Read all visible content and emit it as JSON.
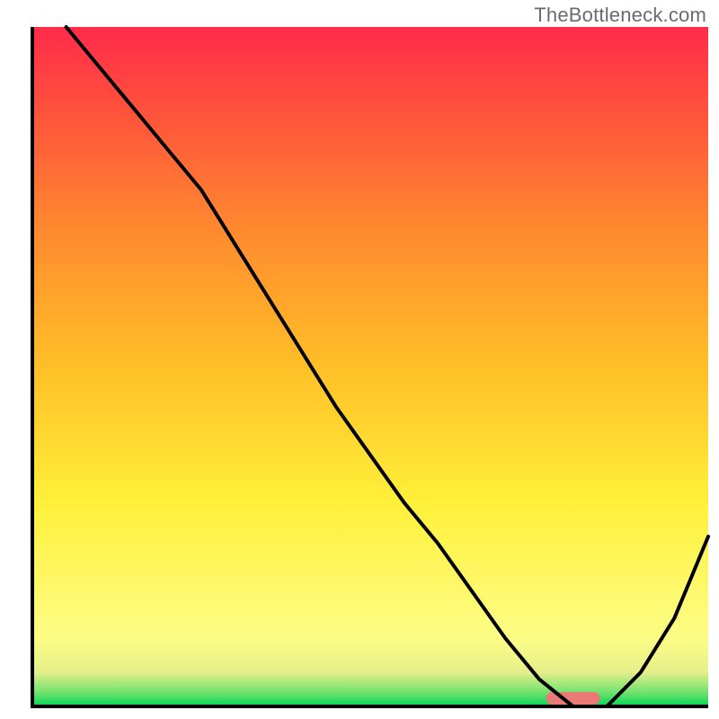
{
  "watermark": "TheBottleneck.com",
  "chart_data": {
    "type": "line",
    "title": "",
    "xlabel": "",
    "ylabel": "",
    "xlim": [
      0,
      100
    ],
    "ylim": [
      0,
      100
    ],
    "grid": false,
    "series": [
      {
        "name": "bottleneck-curve",
        "x": [
          5,
          10,
          15,
          20,
          25,
          30,
          35,
          40,
          45,
          50,
          55,
          60,
          65,
          70,
          75,
          80,
          85,
          90,
          95,
          100
        ],
        "y": [
          100,
          94,
          88,
          82,
          76,
          68,
          60,
          52,
          44,
          37,
          30,
          24,
          17,
          10,
          4,
          0,
          0,
          5,
          13,
          25
        ]
      }
    ],
    "highlight_band": {
      "name": "optimal-range",
      "x_start": 76,
      "x_end": 84,
      "color": "#ea7a78"
    },
    "background_gradient": {
      "stops": [
        {
          "pos": 0.0,
          "color": "#00d455"
        },
        {
          "pos": 0.02,
          "color": "#6fe26e"
        },
        {
          "pos": 0.05,
          "color": "#e4ef8a"
        },
        {
          "pos": 0.1,
          "color": "#fdfd86"
        },
        {
          "pos": 0.3,
          "color": "#fff03a"
        },
        {
          "pos": 0.5,
          "color": "#ffbf27"
        },
        {
          "pos": 0.7,
          "color": "#ff8a2f"
        },
        {
          "pos": 0.85,
          "color": "#ff5a3a"
        },
        {
          "pos": 1.0,
          "color": "#ff2b4a"
        }
      ]
    },
    "axes": {
      "stroke": "#000000",
      "stroke_width": 4
    },
    "curve_style": {
      "stroke": "#000000",
      "stroke_width": 4
    }
  }
}
